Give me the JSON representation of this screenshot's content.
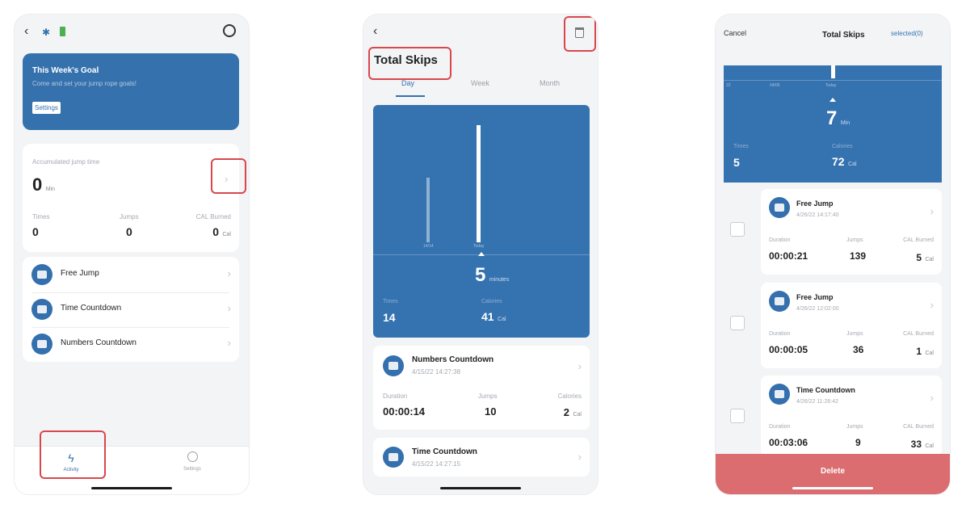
{
  "screen1": {
    "goal_title": "This Week's Goal",
    "goal_subtitle": "Come and set your jump rope goals!",
    "goal_button": "Settings",
    "accum_label": "Accumulated jump time",
    "accum_value": "0",
    "accum_unit": "Min",
    "stats": [
      {
        "label": "Times",
        "value": "0",
        "unit": ""
      },
      {
        "label": "Jumps",
        "value": "0",
        "unit": ""
      },
      {
        "label": "CAL Burned",
        "value": "0",
        "unit": "Cal"
      }
    ],
    "modes": [
      {
        "label": "Free Jump",
        "icon": "free-jump-icon"
      },
      {
        "label": "Time Countdown",
        "icon": "timer-icon"
      },
      {
        "label": "Numbers Countdown",
        "icon": "counter-icon"
      }
    ],
    "tab_activity": "Activity",
    "tab_settings": "Settings"
  },
  "screen2": {
    "title": "Total Skips",
    "tabs": [
      "Day",
      "Week",
      "Month"
    ],
    "active_tab": "Day",
    "bars": [
      {
        "label": "",
        "level": 0.0
      },
      {
        "label": "14/14",
        "level": 0.55
      },
      {
        "label": "Today",
        "level": 1.0
      }
    ],
    "chart_value": "5",
    "chart_unit": "minutes",
    "times_label": "Times",
    "times_value": "14",
    "calories_label": "Calories",
    "calories_value": "41",
    "calories_unit": "Cal",
    "records": [
      {
        "title": "Numbers Countdown",
        "date": "4/15/22 14:27:38",
        "duration_label": "Duration",
        "duration": "00:00:14",
        "jumps_label": "Jumps",
        "jumps": "10",
        "cal_label": "Calories",
        "cal": "2",
        "cal_unit": "Cal"
      },
      {
        "title": "Time Countdown",
        "date": "4/15/22 14:27:15"
      }
    ]
  },
  "screen3": {
    "cancel": "Cancel",
    "title": "Total Skips",
    "selected": "selected(0)",
    "axis_labels": [
      "22",
      "04/05",
      "Today"
    ],
    "chart_value": "7",
    "chart_unit": "Min",
    "times_label": "Times",
    "times_value": "5",
    "calories_label": "Calories",
    "calories_value": "72",
    "calories_unit": "Cal",
    "records": [
      {
        "title": "Free Jump",
        "date": "4/26/22 14:17:40",
        "duration_label": "Duration",
        "duration": "00:00:21",
        "jumps_label": "Jumps",
        "jumps": "139",
        "cal_label": "CAL Burned",
        "cal": "5",
        "cal_unit": "Cal"
      },
      {
        "title": "Free Jump",
        "date": "4/26/22 12:02:00",
        "duration_label": "Duration",
        "duration": "00:00:05",
        "jumps_label": "Jumps",
        "jumps": "36",
        "cal_label": "CAL Burned",
        "cal": "1",
        "cal_unit": "Cal"
      },
      {
        "title": "Time Countdown",
        "date": "4/26/22 11:26:42",
        "duration_label": "Duration",
        "duration": "00:03:06",
        "jumps_label": "Jumps",
        "jumps": "9",
        "cal_label": "CAL Burned",
        "cal": "33",
        "cal_unit": "Cal"
      }
    ],
    "delete_label": "Delete"
  },
  "colors": {
    "brand_blue": "#3471ad",
    "highlight_red": "#d9474d",
    "delete_bar": "#db6c70"
  }
}
